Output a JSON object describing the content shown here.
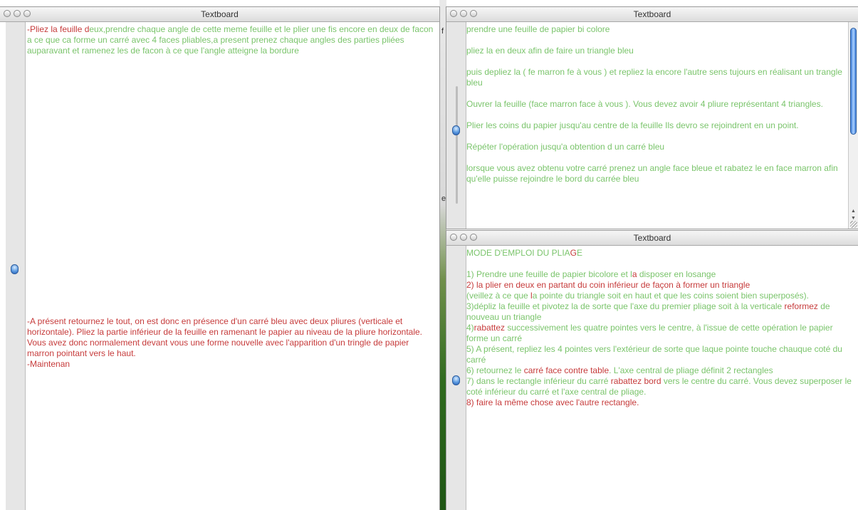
{
  "desktop": {
    "peek_chars": [
      "f",
      "e"
    ]
  },
  "left_window": {
    "title": "Textboard",
    "paragraph1": {
      "red": "-Pliez la feuille  d",
      "green": "eux,prendre chaque angle de cette meme feuille et le plier une fis encore en deux de facon a ce que ca forme un carré avec 4 faces pliables,a present prenez chaque angles des parties pliées auparavant et ramenez les de facon à ce que l'angle atteigne la bordure"
    },
    "paragraph2": "-A présent retournez le tout, on est donc en présence d'un carré bleu avec deux pliures (verticale et horizontale). Pliez la partie inférieur de la feuille en ramenant le papier au niveau de la pliure horizontale. Vous avez donc normalement devant vous une forme nouvelle avec l'apparition d'un tringle de papier marron pointant vers le haut.",
    "paragraph3": "-Maintenan"
  },
  "top_right_window": {
    "title": "Textboard",
    "lines": [
      "prendre une feuille de papier bi colore",
      "pliez la en deux afin de faire un triangle bleu",
      " puis depliez la ( fe marron fe à vous ) et repliez la encore l'autre sens tujours en réalisant un trangle bleu",
      "Ouvrer la feuille (face marron face à vous ). Vous devez avoir 4 pliure représentant 4 triangles.",
      "Plier les coins du papier jusqu'au centre de la feuille Ils devro se rejoindrent en un point.",
      " Répéter l'opération jusqu'a obtention d un carré bleu",
      "lorsque vous avez obtenu votre carré prenez un angle face bleue et rabatez le en face marron afin qu'elle puisse rejoindre le bord du carrée bleu"
    ]
  },
  "bottom_right_window": {
    "title": "Textboard",
    "heading": {
      "green": "MODE D'EMPLOI DU PLIA",
      "red": "G",
      "green2": "E"
    },
    "step1": {
      "a": "1) Prendre une feuille de papier bicolore et l",
      "b": "a",
      "c": " disposer en losange"
    },
    "step2": "2) la plier en deux en partant du coin inférieur de façon à former un triangle",
    "step2b": {
      "a": " (veillez à ce que ",
      "b": "l",
      "c": "a pointe du triangle soit en haut et que les coins soient bien superposés)."
    },
    "step3": {
      "a": "3)dépliz la feuille et pivotez la de sorte que l'axe du premier pliage soit à la verticale ",
      "b": "reformez",
      "c": " de nouveau un triangle"
    },
    "step4": {
      "a": "4)",
      "b": "rabattez",
      "c": " successivement les quatre pointes vers le centre, à l'issue de cette opération le papier forme un carré"
    },
    "step5": "5) A présent, repliez les 4 pointes vers l'extérieur de sorte que laque pointe touche chauque coté du carré",
    "step6": {
      "a": "6) retournez le ",
      "b": "carré face contre table",
      "c": ". L'axe central de pliage définit 2 rectangles"
    },
    "step7": {
      "a": "7) dans le rectangle inférieur du carré ",
      "b": "rabattez  bord",
      "c": " vers le centre du carré. Vous devez superposer le coté inférieur du carré et l'axe central de pliage."
    },
    "step8": "8) faire la même chose avec l'autre rectangle."
  },
  "icons": [
    "close-button-icon",
    "minimize-button-icon",
    "zoom-button-icon",
    "insertion-marker-icon",
    "scroll-up-arrow-icon",
    "scroll-down-arrow-icon",
    "resize-grip-icon"
  ]
}
